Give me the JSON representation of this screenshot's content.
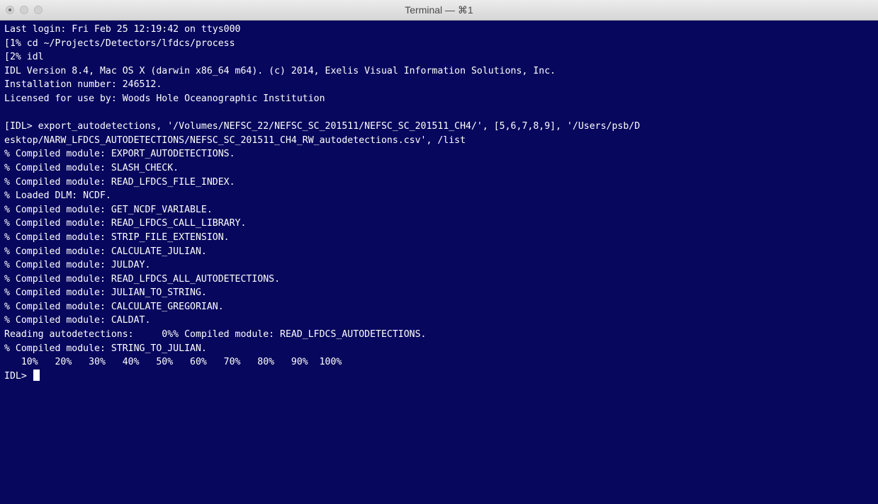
{
  "window": {
    "title": "Terminal — ⌘1"
  },
  "terminal": {
    "lines": [
      "Last login: Fri Feb 25 12:19:42 on ttys000",
      "[1% cd ~/Projects/Detectors/lfdcs/process",
      "[2% idl",
      "IDL Version 8.4, Mac OS X (darwin x86_64 m64). (c) 2014, Exelis Visual Information Solutions, Inc.",
      "Installation number: 246512.",
      "Licensed for use by: Woods Hole Oceanographic Institution",
      "",
      "[IDL> export_autodetections, '/Volumes/NEFSC_22/NEFSC_SC_201511/NEFSC_SC_201511_CH4/', [5,6,7,8,9], '/Users/psb/D",
      "esktop/NARW_LFDCS_AUTODETECTIONS/NEFSC_SC_201511_CH4_RW_autodetections.csv', /list",
      "% Compiled module: EXPORT_AUTODETECTIONS.",
      "% Compiled module: SLASH_CHECK.",
      "% Compiled module: READ_LFDCS_FILE_INDEX.",
      "% Loaded DLM: NCDF.",
      "% Compiled module: GET_NCDF_VARIABLE.",
      "% Compiled module: READ_LFDCS_CALL_LIBRARY.",
      "% Compiled module: STRIP_FILE_EXTENSION.",
      "% Compiled module: CALCULATE_JULIAN.",
      "% Compiled module: JULDAY.",
      "% Compiled module: READ_LFDCS_ALL_AUTODETECTIONS.",
      "% Compiled module: JULIAN_TO_STRING.",
      "% Compiled module: CALCULATE_GREGORIAN.",
      "% Compiled module: CALDAT.",
      "Reading autodetections:     0%% Compiled module: READ_LFDCS_AUTODETECTIONS.",
      "% Compiled module: STRING_TO_JULIAN.",
      "   10%   20%   30%   40%   50%   60%   70%   80%   90%  100%"
    ],
    "prompt": "IDL> "
  }
}
